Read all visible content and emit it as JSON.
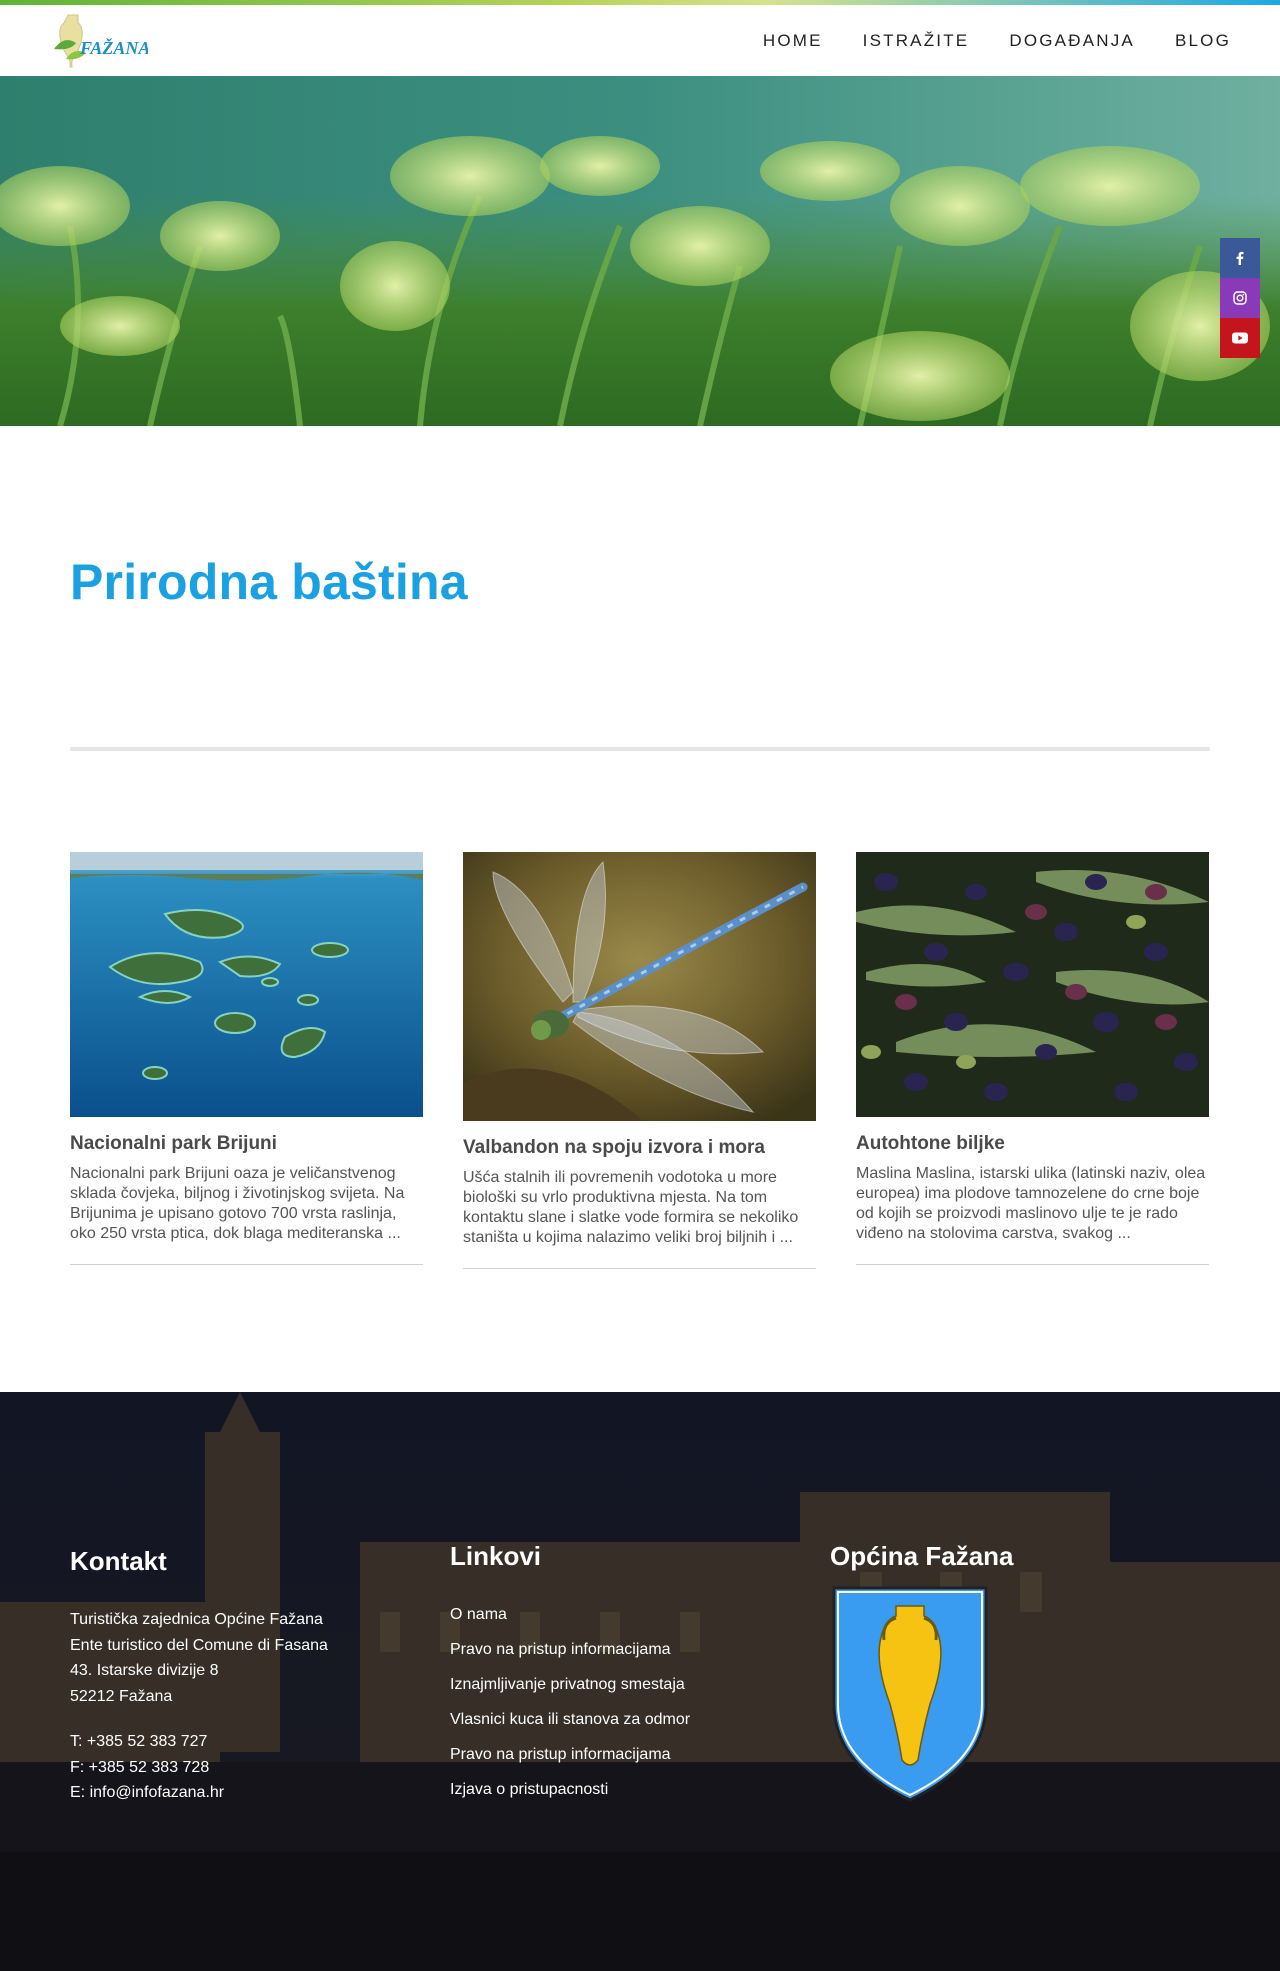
{
  "brand": {
    "logo_text": "FAŽANA",
    "accent": "#1ba1e2"
  },
  "nav": {
    "items": [
      {
        "label": "HOME"
      },
      {
        "label": "ISTRAŽITE"
      },
      {
        "label": "DOGAĐANJA"
      },
      {
        "label": "BLOG"
      }
    ]
  },
  "social": [
    {
      "icon": "facebook-icon",
      "color": "#3b5998"
    },
    {
      "icon": "instagram-icon",
      "color": "#8a3ab9"
    },
    {
      "icon": "youtube-icon",
      "color": "#c4151c"
    }
  ],
  "page": {
    "title": "Prirodna baština"
  },
  "cards": [
    {
      "title": "Nacionalni park Brijuni",
      "excerpt": "Nacionalni park Brijuni oaza je veličanstvenog sklada čovjeka, biljnog i životinjskog svijeta. Na Brijunima je upisano gotovo 700 vrsta raslinja, oko 250 vrsta ptica, dok blaga mediteranska ..."
    },
    {
      "title": "Valbandon na spoju izvora i mora",
      "excerpt": "Ušća stalnih ili povremenih vodotoka u more biološki su vrlo produktivna mjesta. Na tom kontaktu slane i slatke vode formira se nekoliko staništa u kojima nalazimo veliki broj biljnih i ..."
    },
    {
      "title": "Autohtone biljke",
      "excerpt": "Maslina Maslina, istarski ulika (latinski naziv, olea europea) ima plodove tamnozelene do crne boje od kojih se proizvodi maslinovo ulje te je rado viđeno na stolovima carstva, svakog ..."
    }
  ],
  "footer": {
    "kontakt": {
      "heading": "Kontakt",
      "address": [
        "Turistička zajednica Općine Fažana",
        "Ente turistico del Comune di Fasana",
        "43. Istarske divizije 8",
        "52212 Fažana"
      ],
      "phone": "T: +385 52 383 727",
      "fax": "F: +385 52 383 728",
      "email": "E: info@infofazana.hr"
    },
    "linkovi": {
      "heading": "Linkovi",
      "items": [
        "O nama",
        "Pravo na pristup informacijama",
        "Iznajmljivanje privatnog smestaja",
        "Vlasnici kuca ili stanova za odmor",
        "Pravo na pristup informacijama",
        "Izjava o pristupacnosti"
      ]
    },
    "opcina": {
      "heading": "Općina Fažana"
    }
  }
}
